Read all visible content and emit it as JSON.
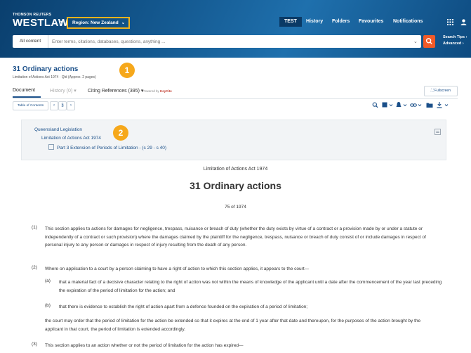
{
  "header": {
    "brand_small": "THOMSON REUTERS",
    "brand": "WESTLAW",
    "brand_caret": "▾",
    "region_label": "Region: New Zealand",
    "region_chevron": "⌄",
    "nav": [
      "TEST",
      "History",
      "Folders",
      "Favourites",
      "Notifications"
    ],
    "grid_icon": "apps-grid-icon",
    "user_icon": "user-icon"
  },
  "search": {
    "scope": "All content",
    "placeholder": "Enter terms, citations, databases, questions, anything ...",
    "caret": "⌄",
    "tips": "Search Tips ›",
    "advanced": "Advanced ›",
    "button_icon": "search-icon"
  },
  "doc": {
    "title": "31 Ordinary actions",
    "subtitle": "Limitation of Actions Act 1974  ·  Qld  (Approx. 2 pages)",
    "badge1": "1",
    "badge2": "2",
    "tabs": {
      "document": "Document",
      "history": "History (0) ▾",
      "citing": "Citing References (395) ▾",
      "keycite_prefix": "Powered by",
      "keycite": "KeyCite",
      "fullscreen": "⛶ Fullscreen"
    },
    "toolbar": {
      "toc": "Table of Contents",
      "prev": "‹",
      "section": "§",
      "next": "›"
    }
  },
  "toc": {
    "level1": "Queensland Legislation",
    "level2": "Limitation of Actions Act 1974",
    "level3": "Part 3 Extension of Periods of Limitation - (s 29 - s 40)"
  },
  "body": {
    "act_title": "Limitation of Actions Act 1974",
    "heading": "31 Ordinary actions",
    "act_number": "75 of 1974",
    "p1_num": "(1)",
    "p1": "This section applies to actions for damages for negligence, trespass, nuisance or breach of duty (whether the duty exists by virtue of a contract or a provision made by or under a statute or independently of a contract or such provision) where the damages claimed by the plaintiff for the negligence, trespass, nuisance or breach of duty consist of or include damages in respect of personal injury to any person or damages in respect of injury resulting from the death of any person.",
    "p2_num": "(2)",
    "p2": "Where on application to a court by a person claiming to have a right of action to which this section applies, it appears to the court—",
    "pa_num": "(a)",
    "pa": "that a material fact of a decisive character relating to the right of action was not within the means of knowledge of the applicant until a date after the commencement of the year last preceding the expiration of the period of limitation for the action; and",
    "pb_num": "(b)",
    "pb": "that there is evidence to establish the right of action apart from a defence founded on the expiration of a period of limitation;",
    "p2_tail": "the court may order that the period of limitation for the action be extended so that it expires at the end of 1 year after that date and thereupon, for the purposes of the action brought by the applicant in that court, the period of limitation is extended accordingly.",
    "p3_num": "(3)",
    "p3": "This section applies to an action whether or not the period of limitation for the action has expired—"
  }
}
